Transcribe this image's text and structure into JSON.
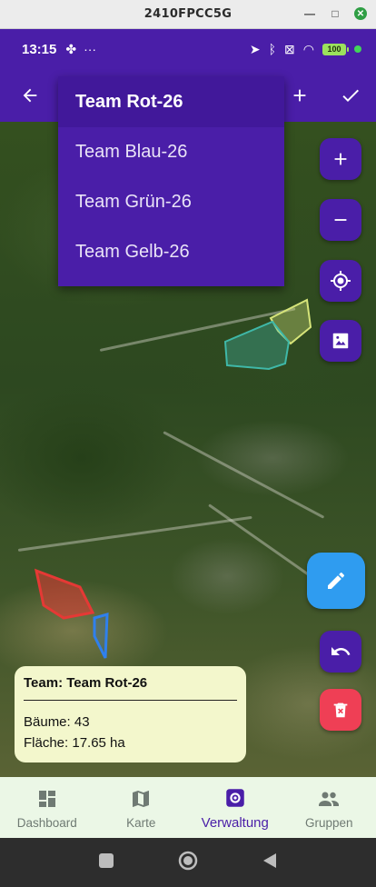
{
  "window": {
    "title": "2410FPCC5G",
    "minimize_icon": "minimize-icon",
    "maximize_icon": "maximize-icon",
    "close_icon": "close-icon"
  },
  "statusbar": {
    "time": "13:15",
    "more": "···",
    "battery": "100"
  },
  "dropdown": {
    "options": [
      {
        "label": "Team Rot-26",
        "selected": true
      },
      {
        "label": "Team Blau-26",
        "selected": false
      },
      {
        "label": "Team Grün-26",
        "selected": false
      },
      {
        "label": "Team Gelb-26",
        "selected": false
      }
    ]
  },
  "info_card": {
    "title": "Team: Team Rot-26",
    "trees_label": "Bäume: 43",
    "area_label": "Fläche: 17.65 ha"
  },
  "bottom_nav": [
    {
      "label": "Dashboard",
      "icon": "dashboard-icon",
      "active": false
    },
    {
      "label": "Karte",
      "icon": "map-icon",
      "active": false
    },
    {
      "label": "Verwaltung",
      "icon": "settings-icon",
      "active": true
    },
    {
      "label": "Gruppen",
      "icon": "group-icon",
      "active": false
    }
  ],
  "colors": {
    "primary": "#4a1ea8",
    "edit_fab": "#2f9cf0",
    "delete_fab": "#ef3f55",
    "info_card_bg": "#f3f7cc",
    "bottom_nav_bg": "#ebf7e6",
    "polygon_red": "#e53935",
    "polygon_blue": "#2f80ed",
    "polygon_teal": "#3fb8a8",
    "polygon_yellow": "#d7e57a"
  }
}
